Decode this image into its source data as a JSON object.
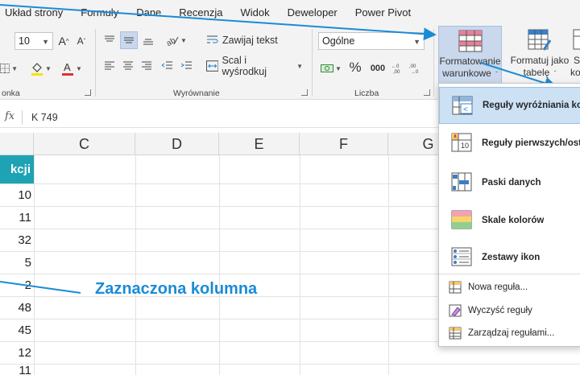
{
  "menu": [
    "Układ strony",
    "Formuły",
    "Dane",
    "Recenzja",
    "Widok",
    "Deweloper",
    "Power Pivot"
  ],
  "ribbon": {
    "font_size": "10",
    "number_format": "Ogólne",
    "wrap_text": "Zawijaj tekst",
    "merge_center": "Scal i wyśrodkuj",
    "percent_symbol": "%",
    "thousands_symbol": "000",
    "group_font_partial": "onka",
    "group_alignment": "Wyrównanie",
    "group_number": "Liczba",
    "cf_button": {
      "line1": "Formatowanie",
      "line2": "warunkowe"
    },
    "format_table_button": {
      "line1": "Formatuj jako",
      "line2": "tabelę"
    },
    "cell_styles_partial": {
      "line1": "S",
      "line2": "kom"
    }
  },
  "formula_bar": {
    "fx_label": "fx",
    "content": "K 749"
  },
  "columns": [
    "C",
    "D",
    "E",
    "F",
    "G"
  ],
  "sheet": {
    "header_partial": "kcji",
    "values": [
      "10",
      "11",
      "32",
      "5",
      "2",
      "48",
      "45",
      "12",
      "11"
    ]
  },
  "annotation": "Zaznaczona kolumna",
  "cf_menu": {
    "items": [
      "Reguły wyróżniania ko",
      "Reguły pierwszych/ost",
      "Paski danych",
      "Skale kolorów",
      "Zestawy ikon"
    ],
    "small_items": [
      "Nowa reguła...",
      "Wyczyść reguły",
      "Zarządzaj regułami..."
    ]
  },
  "colors": {
    "accent": "#1ea2b4",
    "annotation_blue": "#1a8bd6",
    "menu_highlight": "#cde1f5",
    "font_color_red": "#e03030"
  }
}
